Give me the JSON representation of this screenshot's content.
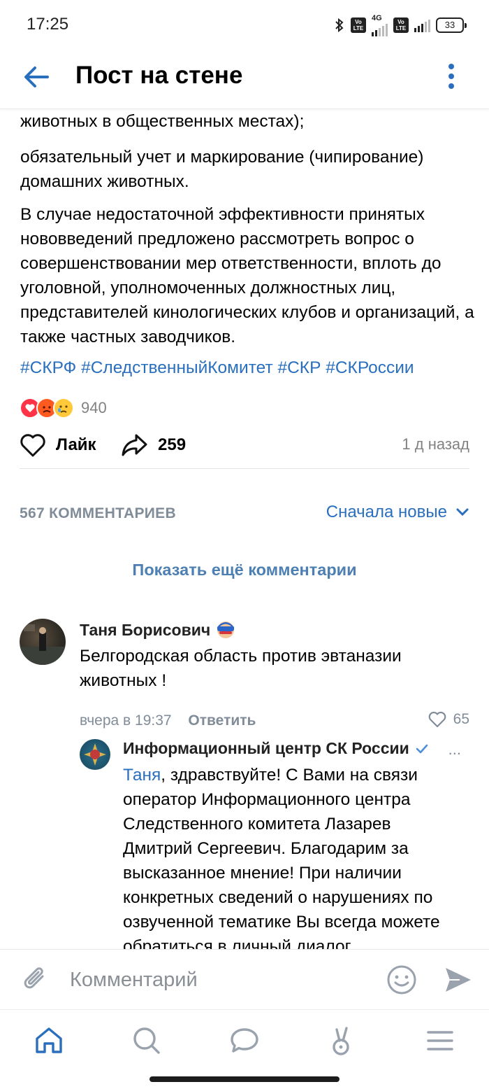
{
  "status_bar": {
    "time": "17:25",
    "battery": "33",
    "network": "4G",
    "volte_label": "Vo LTE",
    "icons": [
      "bluetooth-icon",
      "volte-icon",
      "signal-icon",
      "battery-icon"
    ]
  },
  "header": {
    "title": "Пост на стене",
    "back_icon": "arrow-left-icon",
    "more_icon": "vertical-dots-icon"
  },
  "post": {
    "paragraphs": [
      "животных в общественных местах);",
      "обязательный учет и маркирование (чипирование) домашних животных.",
      "В случае недостаточной эффективности принятых нововведений предложено рассмотреть вопрос о совершенствовании мер ответственности, вплоть до уголовной,  уполномоченных должностных лиц, представителей кинологических клубов и организаций, а также частных заводчиков."
    ],
    "hashtags": "#СКРФ #СледственныйКомитет #СКР #СКРоссии",
    "reactions_count": "940",
    "like_label": "Лайк",
    "shares": "259",
    "time_ago": "1 д назад"
  },
  "comments_section": {
    "count_label": "567 КОММЕНТАРИЕВ",
    "sort_label": "Сначала новые",
    "show_more": "Показать ещё комментарии"
  },
  "comments": [
    {
      "author": "Таня Борисович",
      "text": "Белгородская область против эвтаназии животных !",
      "time": "вчера в 19:37",
      "reply_label": "Ответить",
      "likes": "65"
    }
  ],
  "reply": {
    "author": "Информационный центр СК России",
    "dots": "...",
    "mention": "Таня",
    "text": ", здравствуйте! С Вами на связи оператор Информационного центра Следственного комитета Лазарев Дмитрий Сергеевич. Благодарим за высказанное мнение! При наличии конкретных сведений о нарушениях по озвученной тематике Вы всегда можете обратиться в личный диалог"
  },
  "input": {
    "placeholder": "Комментарий"
  },
  "colors": {
    "accent": "#2a6fbd",
    "nav_active": "#2a6fbd",
    "secondary": "#818c99"
  }
}
